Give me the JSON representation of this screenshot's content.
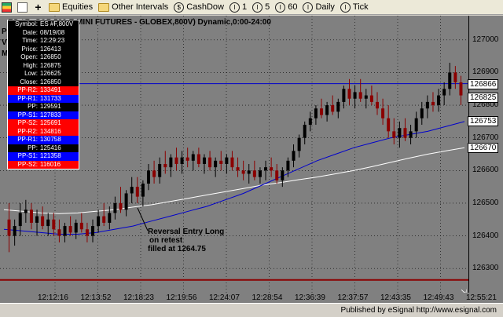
{
  "toolbar": {
    "items": [
      {
        "icon": "grid-icon",
        "label": ""
      },
      {
        "icon": "page-icon",
        "label": ""
      },
      {
        "icon": "plus-icon",
        "label": ""
      },
      {
        "icon": "folder-icon",
        "label": "Equities"
      },
      {
        "icon": "folder-icon",
        "label": "Other Intervals"
      },
      {
        "icon": "link-icon",
        "label": "CashDow"
      },
      {
        "icon": "interval-icon",
        "label": "1",
        "badge": "I"
      },
      {
        "icon": "interval-icon",
        "label": "5",
        "badge": "I"
      },
      {
        "icon": "interval-icon",
        "label": "60",
        "badge": "I"
      },
      {
        "icon": "interval-icon",
        "label": "Daily",
        "badge": "I"
      },
      {
        "icon": "interval-icon",
        "label": "Tick",
        "badge": "I"
      }
    ]
  },
  "chart": {
    "title": "ES #F...S&P 500 E MINI FUTURES - GLOBEX,800V) Dynamic,0:00-24:00",
    "legend_line1": "P",
    "legend_line2": "V                      s",
    "legend_line3": "M                      rs",
    "annotation": [
      "Reversal Entry Long",
      "on retest",
      "filled at 1264.75"
    ],
    "status_text": "Published by eSignal     http://www.esignal.com",
    "colors": {
      "background": "#808080",
      "bull": "#000000",
      "bear": "#8b0000",
      "ma_fast": "#0000cc",
      "ma_slow": "#ffffff",
      "pivot": "#0000cc",
      "bottom_line": "#8b0000"
    }
  },
  "databox": [
    {
      "k": "Symbol:",
      "v": "ES #F,800V",
      "style": "black"
    },
    {
      "k": "Date:",
      "v": "08/19/08",
      "style": "black"
    },
    {
      "k": "Time:",
      "v": "12:29:23",
      "style": "black"
    },
    {
      "k": "Price:",
      "v": "126413",
      "style": "black"
    },
    {
      "k": "Open:",
      "v": "126850",
      "style": "black"
    },
    {
      "k": "High:",
      "v": "126875",
      "style": "black"
    },
    {
      "k": "Low:",
      "v": "126625",
      "style": "black"
    },
    {
      "k": "Close:",
      "v": "126850",
      "style": "black"
    },
    {
      "k": "PP-R2:",
      "v": "133491",
      "style": "red"
    },
    {
      "k": "PP-R1:",
      "v": "131733",
      "style": "blue"
    },
    {
      "k": "PP:",
      "v": "129591",
      "style": "black"
    },
    {
      "k": "PP-S1:",
      "v": "127833",
      "style": "blue"
    },
    {
      "k": "PP-S2:",
      "v": "125691",
      "style": "red"
    },
    {
      "k": "PP-R2:",
      "v": "134816",
      "style": "red"
    },
    {
      "k": "PP-R1:",
      "v": "130758",
      "style": "blue"
    },
    {
      "k": "PP:",
      "v": "125416",
      "style": "black"
    },
    {
      "k": "PP-S1:",
      "v": "121358",
      "style": "blue"
    },
    {
      "k": "PP-S2:",
      "v": "116016",
      "style": "red"
    }
  ],
  "price_axis": {
    "ticks": [
      "127000",
      "126900",
      "126800",
      "126700",
      "126600",
      "126500",
      "126400",
      "126300"
    ],
    "badges": [
      {
        "label": "126866",
        "value": 126866
      },
      {
        "label": "126825",
        "value": 126825
      },
      {
        "label": "126753",
        "value": 126753
      },
      {
        "label": "126670",
        "value": 126670
      }
    ]
  },
  "time_axis": {
    "ticks": [
      "12:12:16",
      "12:13:52",
      "12:18:23",
      "12:19:56",
      "12:24:07",
      "12:28:54",
      "12:36:39",
      "12:37:57",
      "12:43:35",
      "12:49:43",
      "12:55:21"
    ]
  },
  "chart_data": {
    "type": "candlestick",
    "ylim": [
      126250,
      127050
    ],
    "pivot_level": 126866,
    "bottom_level": 126265,
    "bars": [
      [
        126450,
        126500,
        126350,
        126400
      ],
      [
        126400,
        126450,
        126370,
        126430
      ],
      [
        126430,
        126500,
        126400,
        126470
      ],
      [
        126470,
        126510,
        126440,
        126480
      ],
      [
        126480,
        126500,
        126420,
        126440
      ],
      [
        126440,
        126480,
        126400,
        126460
      ],
      [
        126460,
        126490,
        126420,
        126430
      ],
      [
        126430,
        126470,
        126400,
        126450
      ],
      [
        126450,
        126470,
        126400,
        126420
      ],
      [
        126420,
        126450,
        126380,
        126400
      ],
      [
        126400,
        126440,
        126380,
        126430
      ],
      [
        126430,
        126460,
        126400,
        126410
      ],
      [
        126410,
        126450,
        126390,
        126440
      ],
      [
        126440,
        126470,
        126410,
        126420
      ],
      [
        126420,
        126440,
        126380,
        126400
      ],
      [
        126400,
        126450,
        126380,
        126430
      ],
      [
        126430,
        126480,
        126410,
        126460
      ],
      [
        126460,
        126500,
        126430,
        126440
      ],
      [
        126440,
        126490,
        126420,
        126470
      ],
      [
        126470,
        126520,
        126450,
        126500
      ],
      [
        126500,
        126550,
        126470,
        126480
      ],
      [
        126480,
        126540,
        126460,
        126530
      ],
      [
        126530,
        126580,
        126500,
        126550
      ],
      [
        126550,
        126580,
        126500,
        126520
      ],
      [
        126520,
        126570,
        126490,
        126560
      ],
      [
        126560,
        126620,
        126540,
        126600
      ],
      [
        126600,
        126630,
        126560,
        126580
      ],
      [
        126580,
        126640,
        126560,
        126620
      ],
      [
        126620,
        126660,
        126590,
        126610
      ],
      [
        126610,
        126650,
        126580,
        126640
      ],
      [
        126640,
        126670,
        126600,
        126620
      ],
      [
        126620,
        126660,
        126590,
        126640
      ],
      [
        126640,
        126670,
        126610,
        126630
      ],
      [
        126630,
        126660,
        126600,
        126650
      ],
      [
        126650,
        126670,
        126610,
        126620
      ],
      [
        126620,
        126650,
        126590,
        126640
      ],
      [
        126640,
        126660,
        126600,
        126610
      ],
      [
        126610,
        126640,
        126580,
        126630
      ],
      [
        126630,
        126660,
        126600,
        126620
      ],
      [
        126620,
        126650,
        126590,
        126640
      ],
      [
        126640,
        126660,
        126600,
        126610
      ],
      [
        126610,
        126640,
        126580,
        126600
      ],
      [
        126600,
        126630,
        126570,
        126590
      ],
      [
        126590,
        126620,
        126560,
        126600
      ],
      [
        126600,
        126630,
        126570,
        126580
      ],
      [
        126580,
        126610,
        126560,
        126600
      ],
      [
        126600,
        126630,
        126570,
        126610
      ],
      [
        126610,
        126640,
        126580,
        126600
      ],
      [
        126600,
        126620,
        126560,
        126570
      ],
      [
        126570,
        126610,
        126550,
        126600
      ],
      [
        126600,
        126640,
        126580,
        126630
      ],
      [
        126630,
        126680,
        126610,
        126660
      ],
      [
        126660,
        126710,
        126640,
        126700
      ],
      [
        126700,
        126750,
        126680,
        126740
      ],
      [
        126740,
        126780,
        126720,
        126760
      ],
      [
        126760,
        126800,
        126740,
        126790
      ],
      [
        126790,
        126820,
        126760,
        126770
      ],
      [
        126770,
        126810,
        126750,
        126800
      ],
      [
        126800,
        126830,
        126770,
        126780
      ],
      [
        126780,
        126820,
        126760,
        126810
      ],
      [
        126810,
        126860,
        126790,
        126850
      ],
      [
        126850,
        126880,
        126800,
        126820
      ],
      [
        126820,
        126860,
        126790,
        126840
      ],
      [
        126840,
        126880,
        126810,
        126820
      ],
      [
        126820,
        126850,
        126790,
        126830
      ],
      [
        126830,
        126860,
        126800,
        126810
      ],
      [
        126810,
        126840,
        126770,
        126790
      ],
      [
        126790,
        126820,
        126740,
        126760
      ],
      [
        126760,
        126800,
        126700,
        126720
      ],
      [
        126720,
        126760,
        126680,
        126700
      ],
      [
        126700,
        126750,
        126670,
        126730
      ],
      [
        126730,
        126760,
        126690,
        126700
      ],
      [
        126700,
        126740,
        126680,
        126720
      ],
      [
        126720,
        126780,
        126700,
        126760
      ],
      [
        126760,
        126810,
        126740,
        126790
      ],
      [
        126790,
        126830,
        126760,
        126810
      ],
      [
        126810,
        126840,
        126780,
        126800
      ],
      [
        126800,
        126850,
        126780,
        126830
      ],
      [
        126830,
        126870,
        126800,
        126850
      ],
      [
        126850,
        126930,
        126830,
        126900
      ],
      [
        126900,
        126920,
        126850,
        126870
      ],
      [
        126870,
        126890,
        126800,
        126830
      ]
    ],
    "ma_fast": [
      126420,
      126415,
      126410,
      126405,
      126405,
      126410,
      126420,
      126430,
      126445,
      126460,
      126475,
      126490,
      126510,
      126530,
      126555,
      126580,
      126605,
      126630,
      126650,
      126670,
      126685,
      126700,
      126710,
      126720,
      126735,
      126750
    ],
    "ma_slow": [
      126480,
      126475,
      126470,
      126468,
      126470,
      126475,
      126480,
      126488,
      126495,
      126505,
      126515,
      126525,
      126535,
      126545,
      126555,
      126563,
      126572,
      126580,
      126590,
      126600,
      126612,
      126625,
      126638,
      126650,
      126660,
      126670
    ]
  }
}
